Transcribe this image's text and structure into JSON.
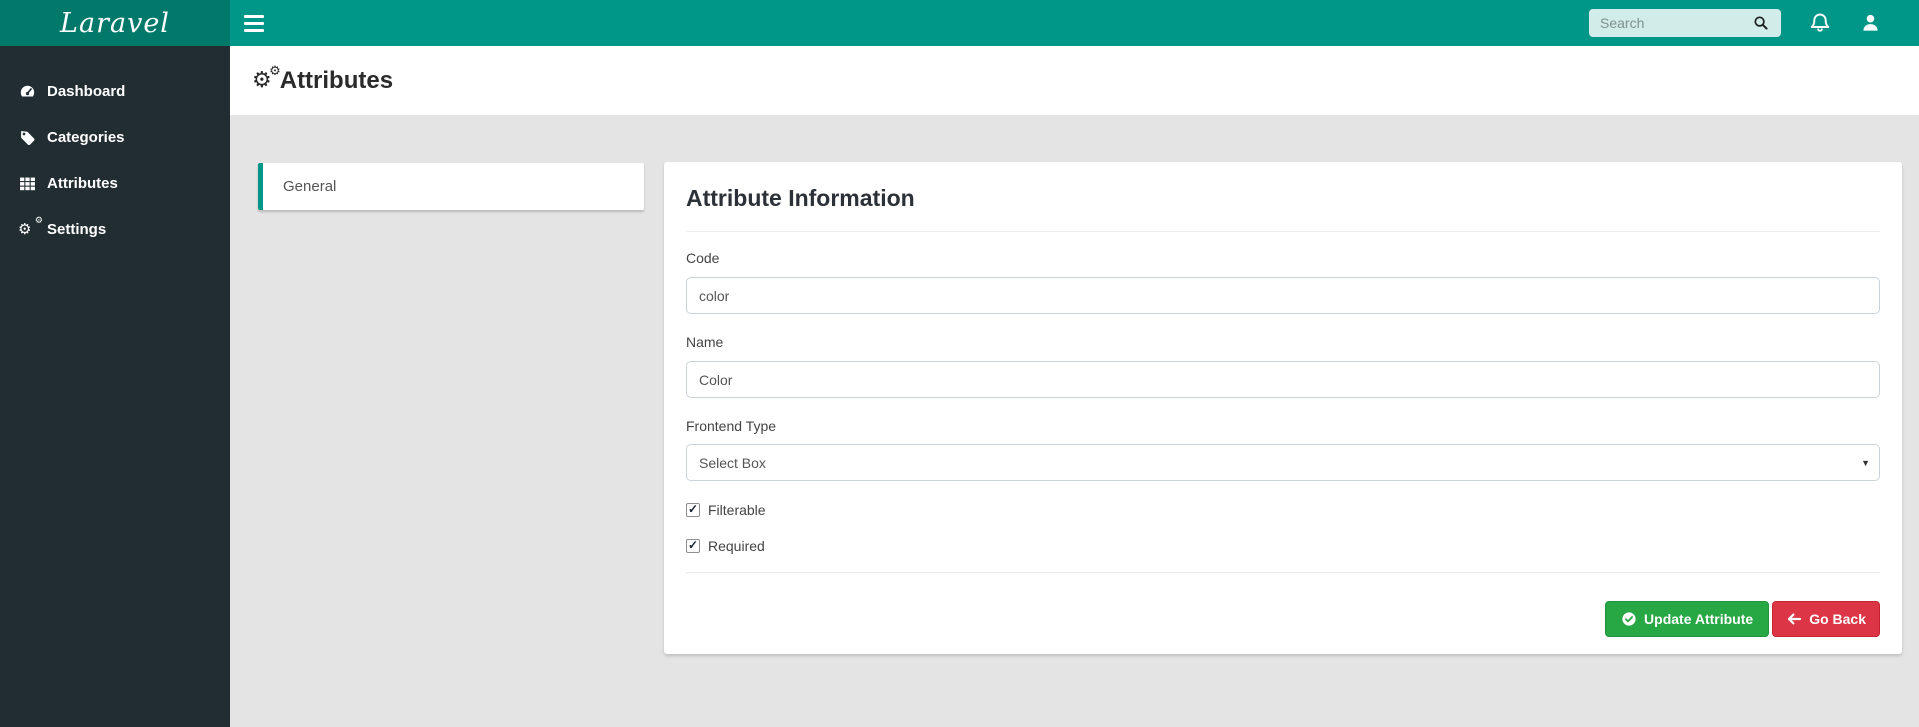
{
  "brand": {
    "logo": "Laravel"
  },
  "header": {
    "search_placeholder": "Search"
  },
  "sidebar": {
    "items": [
      {
        "label": "Dashboard",
        "icon": "gauge-icon"
      },
      {
        "label": "Categories",
        "icon": "tag-icon"
      },
      {
        "label": "Attributes",
        "icon": "grid-icon"
      },
      {
        "label": "Settings",
        "icon": "gears-icon"
      }
    ]
  },
  "page": {
    "title": "Attributes"
  },
  "tabs": {
    "general_label": "General"
  },
  "form": {
    "panel_title": "Attribute Information",
    "fields": {
      "code": {
        "label": "Code",
        "value": "color"
      },
      "name": {
        "label": "Name",
        "value": "Color"
      },
      "frontend_type": {
        "label": "Frontend Type",
        "value": "Select Box"
      }
    },
    "checkboxes": [
      {
        "label": "Filterable",
        "checked": true
      },
      {
        "label": "Required",
        "checked": true
      }
    ]
  },
  "actions": {
    "update_label": "Update Attribute",
    "back_label": "Go Back"
  },
  "icons": {
    "gear": "⚙",
    "check": "✓",
    "caret": "▼"
  },
  "colors": {
    "navbar_teal": "#009688",
    "logo_teal": "#00796b",
    "sidebar_dark": "#222d32",
    "page_bg": "#e4e4e4",
    "success_green": "#28a745",
    "danger_red": "#dc3545",
    "tab_accent": "#009688"
  }
}
